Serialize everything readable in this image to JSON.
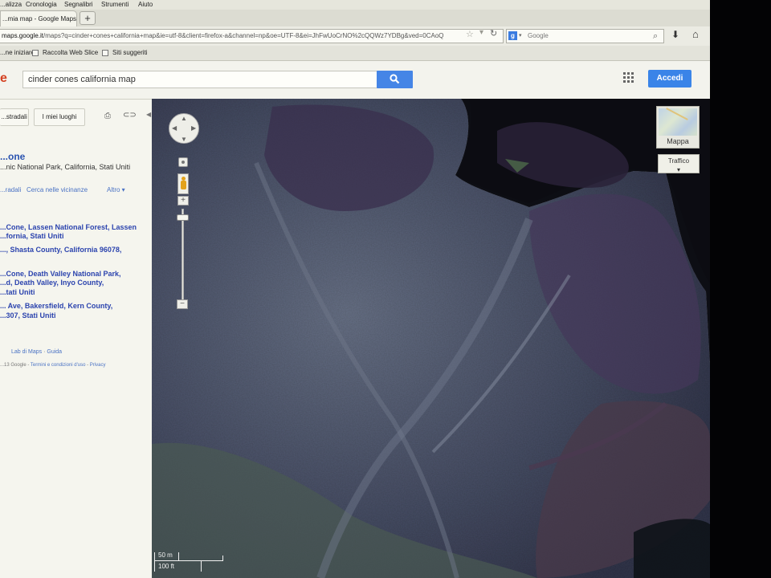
{
  "browser": {
    "menu": [
      "...alizza",
      "Cronologia",
      "Segnalibri",
      "Strumenti",
      "Aiuto"
    ],
    "tab_title": "...mia map - Google Maps",
    "new_tab_label": "+",
    "url_host": "maps.google.it",
    "url_rest": "/maps?q=cinder+cones+california+map&ie=utf-8&client=firefox-a&channel=np&oe=UTF-8&ei=JhFwUoCrNO%2cQQWz7YDBg&ved=0CAoQ",
    "search_engine_badge": "g",
    "search_placeholder": "Google",
    "bookmarks": [
      "...ne iniziare",
      "Raccolta Web Slice",
      "Siti suggeriti"
    ]
  },
  "google": {
    "logo_fragment": "e",
    "query": "cinder cones california map",
    "search_button_icon": "search-icon",
    "apps_icon": "apps-grid-icon",
    "sign_in": "Accedi"
  },
  "panel": {
    "btn_directions": "...stradali",
    "btn_my_places": "I miei luoghi",
    "place_title": "...one",
    "place_address": "...nic National Park, California, Stati Uniti",
    "actions": [
      "...radali",
      "Cerca nelle vicinanze",
      "Altro ▾"
    ],
    "results": [
      "...Cone, Lassen National Forest, Lassen",
      "...fornia, Stati Uniti",
      "..., Shasta County, California 96078,",
      "...Cone, Death Valley National Park,",
      "...d, Death Valley, Inyo County,",
      "...tati Uniti",
      "... Ave, Bakersfield, Kern County,",
      "...307, Stati Uniti"
    ],
    "footer_lab": "Lab di Maps",
    "footer_sep": " · ",
    "footer_help": "Guida",
    "footer_copyright": "...13 Google - ",
    "footer_terms": "Termini e condizioni d'uso",
    "footer_privacy": "Privacy"
  },
  "map": {
    "type_button": "Mappa",
    "traffic_button": "Traffico",
    "traffic_arrow": "▾",
    "scale_metric": "50 m",
    "scale_imperial": "100 ft",
    "zoom_plus": "+",
    "zoom_minus": "−",
    "zoom_level_fraction": 0.07
  },
  "colors": {
    "accent_blue": "#3a84e8",
    "link_blue": "#2c44ae"
  }
}
